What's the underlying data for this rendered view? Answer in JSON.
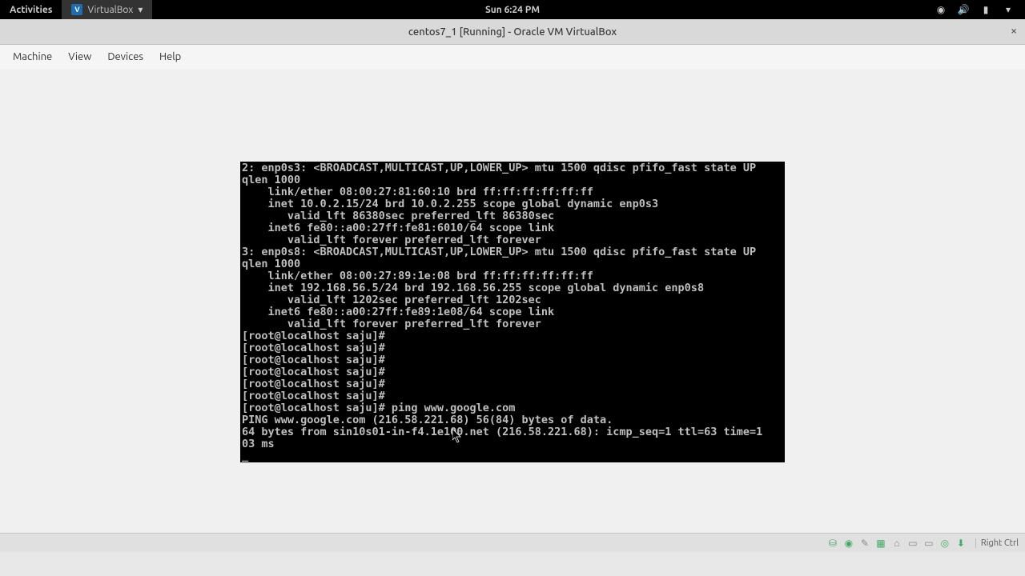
{
  "topbar": {
    "activities": "Activities",
    "app_name": "VirtualBox",
    "dropdown": "▾",
    "clock": "Sun  6:24 PM"
  },
  "window": {
    "title": "centos7_1 [Running] - Oracle VM VirtualBox",
    "menus": {
      "machine": "Machine",
      "view": "View",
      "devices": "Devices",
      "help": "Help"
    },
    "close": "×"
  },
  "terminal": {
    "lines": [
      "2: enp0s3: <BROADCAST,MULTICAST,UP,LOWER_UP> mtu 1500 qdisc pfifo_fast state UP",
      "qlen 1000",
      "    link/ether 08:00:27:81:60:10 brd ff:ff:ff:ff:ff:ff",
      "    inet 10.0.2.15/24 brd 10.0.2.255 scope global dynamic enp0s3",
      "       valid_lft 86380sec preferred_lft 86380sec",
      "    inet6 fe80::a00:27ff:fe81:6010/64 scope link",
      "       valid_lft forever preferred_lft forever",
      "3: enp0s8: <BROADCAST,MULTICAST,UP,LOWER_UP> mtu 1500 qdisc pfifo_fast state UP",
      "qlen 1000",
      "    link/ether 08:00:27:89:1e:08 brd ff:ff:ff:ff:ff:ff",
      "    inet 192.168.56.5/24 brd 192.168.56.255 scope global dynamic enp0s8",
      "       valid_lft 1202sec preferred_lft 1202sec",
      "    inet6 fe80::a00:27ff:fe89:1e08/64 scope link",
      "       valid_lft forever preferred_lft forever",
      "[root@localhost saju]#",
      "[root@localhost saju]#",
      "[root@localhost saju]#",
      "[root@localhost saju]#",
      "[root@localhost saju]#",
      "[root@localhost saju]#",
      "[root@localhost saju]# ping www.google.com",
      "PING www.google.com (216.58.221.68) 56(84) bytes of data.",
      "64 bytes from sin10s01-in-f4.1e100.net (216.58.221.68): icmp_seq=1 ttl=63 time=1",
      "03 ms",
      "_"
    ]
  },
  "statusbar": {
    "host_key": "Right Ctrl"
  }
}
